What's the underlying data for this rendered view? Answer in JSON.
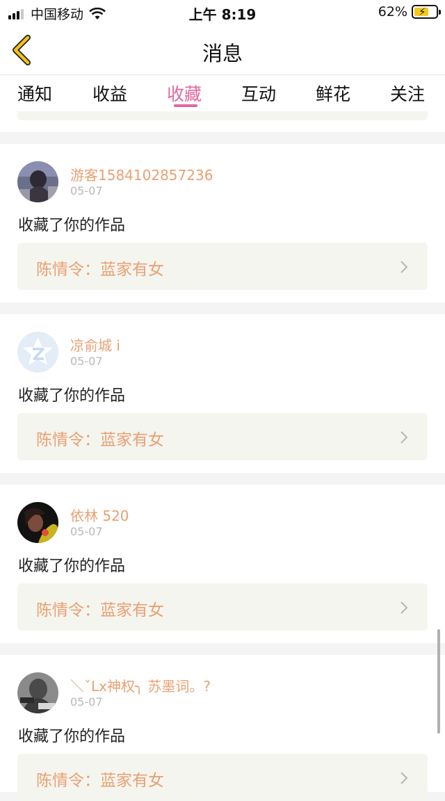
{
  "status": {
    "carrier": "中国移动",
    "time": "上午 8:19",
    "battery_pct": "62%"
  },
  "nav": {
    "title": "消息"
  },
  "tabs": [
    {
      "label": "通知",
      "active": false
    },
    {
      "label": "收益",
      "active": false
    },
    {
      "label": "收藏",
      "active": true
    },
    {
      "label": "互动",
      "active": false
    },
    {
      "label": "鲜花",
      "active": false
    },
    {
      "label": "关注",
      "active": false
    }
  ],
  "messages": [
    {
      "username": "游客1584102857236",
      "date": "05-07",
      "action": "收藏了你的作品",
      "work": "陈情令：蓝家有女",
      "avatar": "photo-avatar"
    },
    {
      "username": "凉俞城 i",
      "date": "05-07",
      "action": "收藏了你的作品",
      "work": "陈情令：蓝家有女",
      "avatar": "default-star-avatar"
    },
    {
      "username": "依林 520",
      "date": "05-07",
      "action": "收藏了你的作品",
      "work": "陈情令：蓝家有女",
      "avatar": "photo-avatar"
    },
    {
      "username": "＼ˇLx神权╮ 苏墨词。?",
      "date": "05-07",
      "action": "收藏了你的作品",
      "work": "陈情令：蓝家有女",
      "avatar": "photo-avatar"
    }
  ],
  "colors": {
    "accent": "#e2679e",
    "username": "#e9a072",
    "work_bg": "#f5f5ef",
    "back_arrow": "#f2c21a"
  }
}
